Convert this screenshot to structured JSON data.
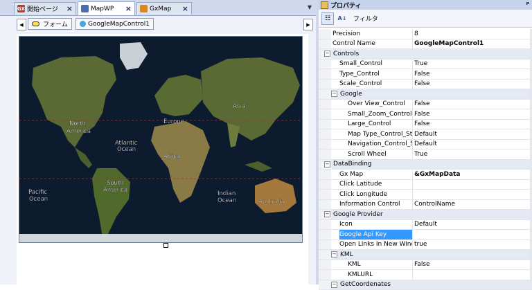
{
  "tabs": [
    {
      "label": "開始ページ",
      "icon": "gx-start-icon",
      "icon_text": "GX",
      "icon_color": "#c0392b",
      "active": false
    },
    {
      "label": "MapWP",
      "icon": "web-panel-icon",
      "icon_text": "",
      "icon_color": "#4a6fb0",
      "active": true
    },
    {
      "label": "GxMap",
      "icon": "gxmap-icon",
      "icon_text": "",
      "icon_color": "#d9881a",
      "active": false
    }
  ],
  "breadcrumbs": {
    "form_label": "フォーム",
    "control_label": "GoogleMapControl1"
  },
  "map": {
    "labels": [
      {
        "text": "North America"
      },
      {
        "text": "Atlantic Ocean"
      },
      {
        "text": "Europe"
      },
      {
        "text": "Asia"
      },
      {
        "text": "Africa"
      },
      {
        "text": "Pacific Ocean"
      },
      {
        "text": "South America"
      },
      {
        "text": "Indian Ocean"
      },
      {
        "text": "Australia"
      }
    ]
  },
  "properties_panel": {
    "title": "プロパティ",
    "pin": "ᵖ",
    "filter_label": "フィルタ",
    "rows": [
      {
        "type": "prop",
        "name": "Precision",
        "value": "8",
        "indent": 1
      },
      {
        "type": "prop",
        "name": "Control Name",
        "value": "GoogleMapControl1",
        "indent": 1,
        "bold": true
      },
      {
        "type": "cat",
        "name": "Controls",
        "indent": 1
      },
      {
        "type": "prop",
        "name": "Small_Control",
        "value": "True",
        "indent": 2
      },
      {
        "type": "prop",
        "name": "Type_Control",
        "value": "False",
        "indent": 2
      },
      {
        "type": "prop",
        "name": "Scale_Control",
        "value": "False",
        "indent": 2
      },
      {
        "type": "cat",
        "name": "Google",
        "indent": 2
      },
      {
        "type": "prop",
        "name": "Over View_Control",
        "value": "False",
        "indent": 3
      },
      {
        "type": "prop",
        "name": "Small_Zoom_Control",
        "value": "False",
        "indent": 3
      },
      {
        "type": "prop",
        "name": "Large_Control",
        "value": "False",
        "indent": 3
      },
      {
        "type": "prop",
        "name": "Map Type_Control_Sty",
        "value": "Default",
        "indent": 3
      },
      {
        "type": "prop",
        "name": "Navigation_Control_St",
        "value": "Default",
        "indent": 3
      },
      {
        "type": "prop",
        "name": "Scroll Wheel",
        "value": "True",
        "indent": 3
      },
      {
        "type": "cat",
        "name": "DataBinding",
        "indent": 1
      },
      {
        "type": "prop",
        "name": "Gx Map",
        "value": "&GxMapData",
        "indent": 2,
        "bold": true
      },
      {
        "type": "prop",
        "name": "Click Latitude",
        "value": "",
        "indent": 2
      },
      {
        "type": "prop",
        "name": "Click Longitude",
        "value": "",
        "indent": 2
      },
      {
        "type": "prop",
        "name": "Information Control",
        "value": "ControlName",
        "indent": 2
      },
      {
        "type": "cat",
        "name": "Google Provider",
        "indent": 1
      },
      {
        "type": "prop",
        "name": "Icon",
        "value": "Default",
        "indent": 2
      },
      {
        "type": "prop",
        "name": "Google Api Key",
        "value": "",
        "indent": 2,
        "selected": true
      },
      {
        "type": "prop",
        "name": "Open Links In New Windc",
        "value": "true",
        "indent": 2
      },
      {
        "type": "cat",
        "name": "KML",
        "indent": 2
      },
      {
        "type": "prop",
        "name": "KML",
        "value": "False",
        "indent": 3
      },
      {
        "type": "prop",
        "name": "KMLURL",
        "value": "",
        "indent": 3
      },
      {
        "type": "cat",
        "name": "GetCoordenates",
        "indent": 2
      }
    ]
  },
  "colors": {
    "selection": "#3399ff",
    "map_ocean": "#0d1b2f",
    "map_land": "#4d5f2c"
  }
}
